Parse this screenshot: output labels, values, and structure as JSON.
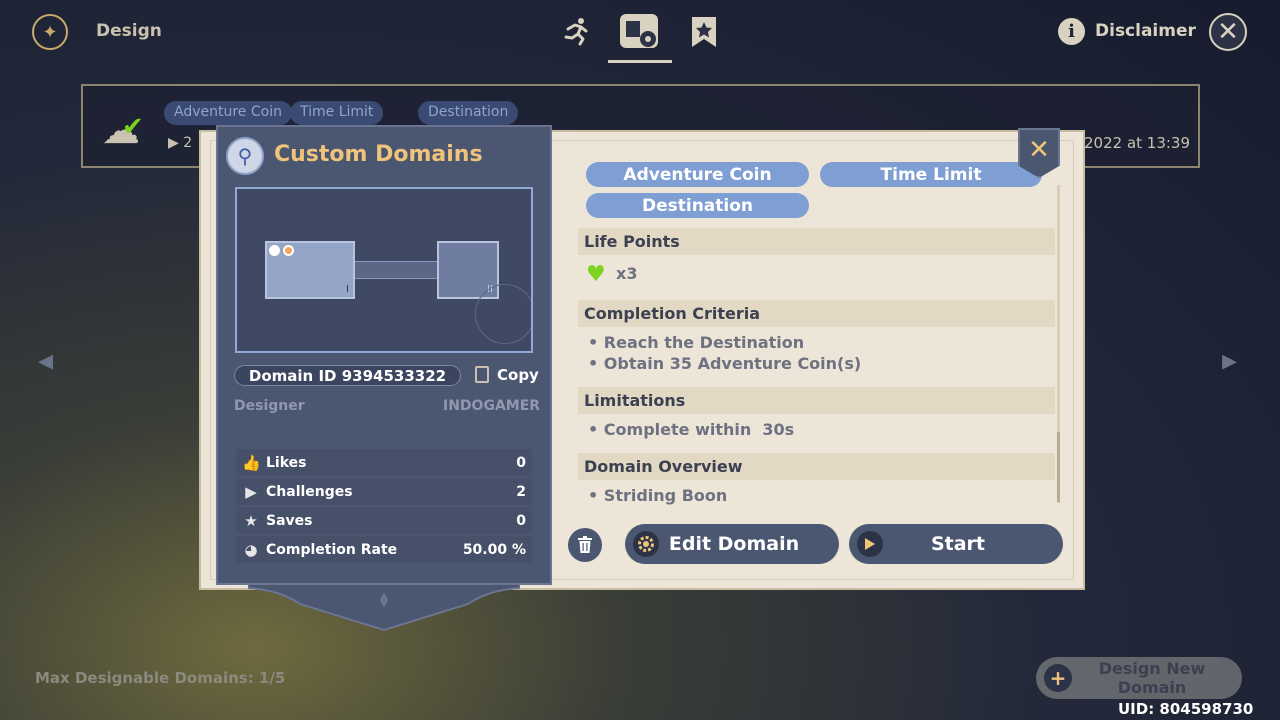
{
  "topbar": {
    "page_label": "Design",
    "disclaimer_label": "Disclaimer",
    "tabs": [
      {
        "icon": "running-figure-icon"
      },
      {
        "icon": "domain-design-icon",
        "active": true
      },
      {
        "icon": "bookmark-star-icon"
      }
    ]
  },
  "background_row": {
    "tags": [
      "Adventure Coin",
      "Time Limit",
      "Destination"
    ],
    "play_count_prefix": "▶ 2",
    "date_fragment": "2022 at 13:39"
  },
  "modal": {
    "title": "Custom Domains",
    "domain_id": "Domain ID 9394533322",
    "copy_label": "Copy",
    "designer_label": "Designer",
    "designer_value": "INDOGAMER",
    "stats": [
      {
        "label": "Likes",
        "value": "0",
        "icon": "thumbs-up-icon"
      },
      {
        "label": "Challenges",
        "value": "2",
        "icon": "play-icon"
      },
      {
        "label": "Saves",
        "value": "0",
        "icon": "star-icon"
      },
      {
        "label": "Completion Rate",
        "value": "50.00 %",
        "icon": "pie-chart-icon"
      }
    ],
    "tags": [
      "Adventure Coin",
      "Time Limit",
      "Destination"
    ],
    "sections": {
      "life_points": {
        "heading": "Life Points",
        "value": "x3"
      },
      "completion_criteria": {
        "heading": "Completion Criteria",
        "items": [
          "• Reach the Destination",
          "• Obtain 35 Adventure Coin(s)"
        ]
      },
      "limitations": {
        "heading": "Limitations",
        "items": [
          "• Complete within  30s"
        ]
      },
      "domain_overview": {
        "heading": "Domain Overview",
        "items": [
          "• Striding Boon"
        ]
      }
    },
    "buttons": {
      "edit": "Edit Domain",
      "start": "Start"
    },
    "preview_room_labels": [
      "I",
      "II"
    ]
  },
  "footer": {
    "max_domains": "Max Designable Domains: 1/5",
    "design_new_line1": "Design New",
    "design_new_line2": "Domain",
    "uid": "UID: 804598730"
  },
  "colors": {
    "accent_gold": "#efc47a",
    "panel_blue": "#4b5671",
    "tag_blue": "#7f9fd4",
    "heart_green": "#7ed321",
    "parchment": "#ede5d7"
  }
}
